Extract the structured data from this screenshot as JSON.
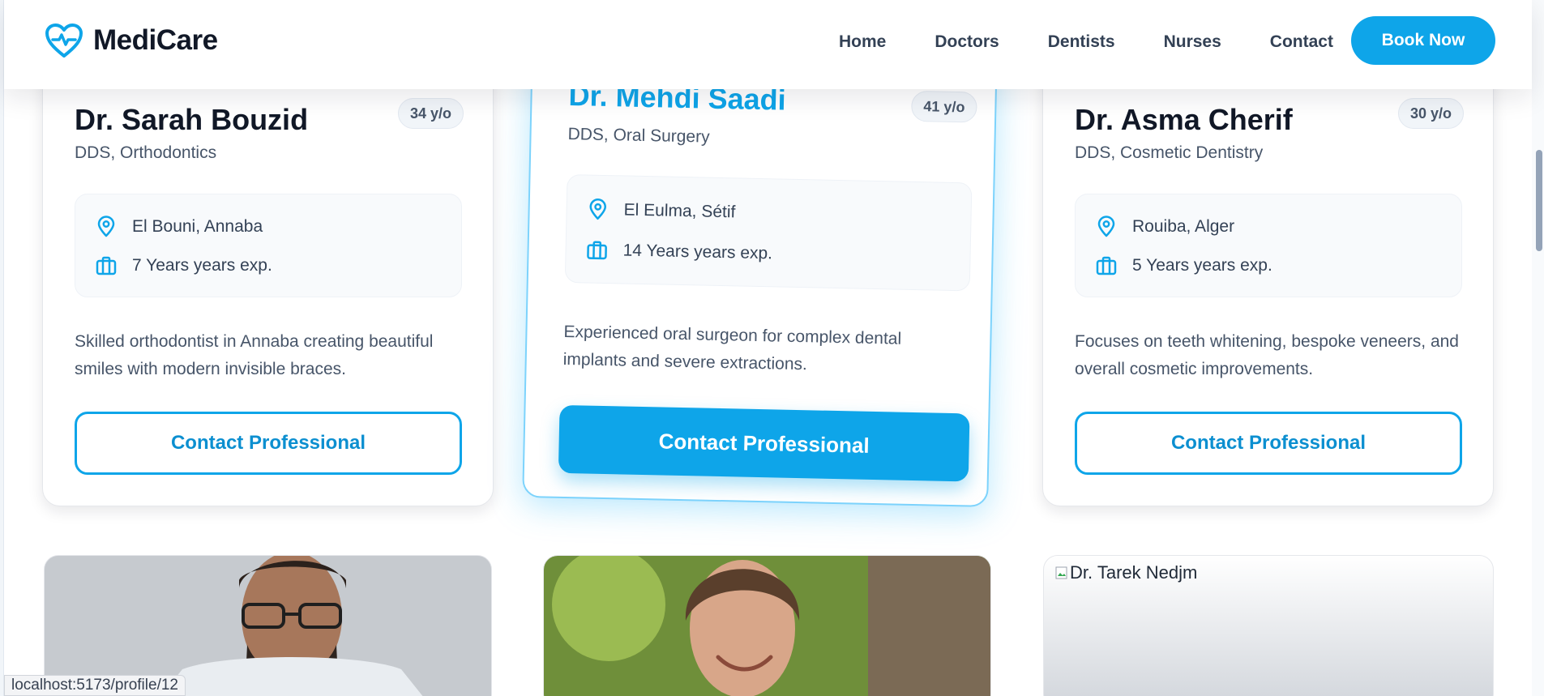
{
  "navbar": {
    "brand": "MediCare",
    "links": [
      "Home",
      "Doctors",
      "Dentists",
      "Nurses",
      "Contact"
    ],
    "cta": "Book Now"
  },
  "cards": [
    {
      "name": "Dr. Sarah Bouzid",
      "age": "34 y/o",
      "specialty": "DDS, Orthodontics",
      "location": "El Bouni, Annaba",
      "experience": "7 Years years exp.",
      "description": "Skilled orthodontist in Annaba creating beautiful smiles with modern invisible braces.",
      "button": "Contact Professional"
    },
    {
      "name": "Dr. Mehdi Saadi",
      "age": "41 y/o",
      "specialty": "DDS, Oral Surgery",
      "location": "El Eulma, Sétif",
      "experience": "14 Years years exp.",
      "description": "Experienced oral surgeon for complex dental implants and severe extractions.",
      "button": "Contact Professional"
    },
    {
      "name": "Dr. Asma Cherif",
      "age": "30 y/o",
      "specialty": "DDS, Cosmetic Dentistry",
      "location": "Rouiba, Alger",
      "experience": "5 Years years exp.",
      "description": "Focuses on teeth whitening, bespoke veneers, and overall cosmetic improvements.",
      "button": "Contact Professional"
    }
  ],
  "photos": {
    "broken_alt": "Dr. Tarek Nedjm"
  },
  "status_bar": "localhost:5173/profile/12",
  "colors": {
    "accent": "#0ea5e9",
    "accent_dark": "#0c8fd0",
    "featured_name": "#0ea5e9"
  }
}
